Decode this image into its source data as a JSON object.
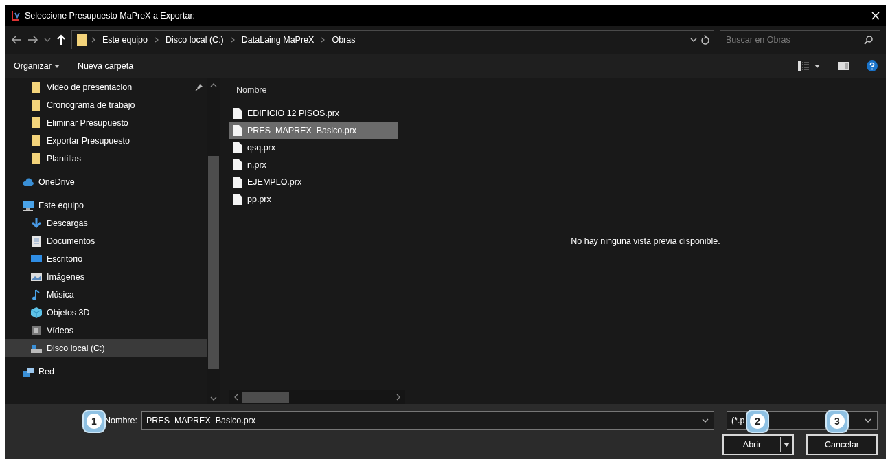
{
  "window": {
    "title": "Seleccione Presupuesto MaPreX a Exportar:"
  },
  "address_bar": {
    "segments": [
      "Este equipo",
      "Disco local (C:)",
      "DataLaing MaPreX",
      "Obras"
    ]
  },
  "search": {
    "placeholder": "Buscar en Obras"
  },
  "toolbar": {
    "organize": "Organizar",
    "new_folder": "Nueva carpeta"
  },
  "sidebar": {
    "quick_access_children": [
      {
        "label": "Video de presentacion",
        "kind": "folder",
        "pinned": true,
        "selected": false
      },
      {
        "label": "Cronograma de trabajo",
        "kind": "folder",
        "pinned": false,
        "selected": false
      },
      {
        "label": "Eliminar Presupuesto",
        "kind": "folder",
        "pinned": false,
        "selected": false
      },
      {
        "label": "Exportar Presupuesto",
        "kind": "folder",
        "pinned": false,
        "selected": false
      },
      {
        "label": "Plantillas",
        "kind": "folder",
        "pinned": false,
        "selected": false
      }
    ],
    "items": [
      {
        "label": "OneDrive",
        "kind": "cloud",
        "selected": false
      },
      {
        "label": "Este equipo",
        "kind": "computer",
        "selected": false,
        "children": [
          {
            "label": "Descargas",
            "kind": "download",
            "selected": false
          },
          {
            "label": "Documentos",
            "kind": "document",
            "selected": false
          },
          {
            "label": "Escritorio",
            "kind": "desktop",
            "selected": false
          },
          {
            "label": "Imágenes",
            "kind": "picture",
            "selected": false
          },
          {
            "label": "Música",
            "kind": "music",
            "selected": false
          },
          {
            "label": "Objetos 3D",
            "kind": "cube",
            "selected": false
          },
          {
            "label": "Vídeos",
            "kind": "video",
            "selected": false
          },
          {
            "label": "Disco local (C:)",
            "kind": "drive",
            "selected": true
          }
        ]
      },
      {
        "label": "Red",
        "kind": "network",
        "selected": false
      }
    ]
  },
  "file_list": {
    "column": "Nombre",
    "files": [
      {
        "name": "EDIFICIO 12 PISOS.prx",
        "selected": false
      },
      {
        "name": "PRES_MAPREX_Basico.prx",
        "selected": true
      },
      {
        "name": "qsq.prx",
        "selected": false
      },
      {
        "name": "n.prx",
        "selected": false
      },
      {
        "name": "EJEMPLO.prx",
        "selected": false
      },
      {
        "name": "pp.prx",
        "selected": false
      }
    ]
  },
  "preview": {
    "message": "No hay ninguna vista previa disponible."
  },
  "footer": {
    "name_label": "Nombre:",
    "name_value": "PRES_MAPREX_Basico.prx",
    "filter": "(*.p",
    "open": "Abrir",
    "cancel": "Cancelar"
  },
  "callouts": [
    "1",
    "2",
    "3"
  ]
}
